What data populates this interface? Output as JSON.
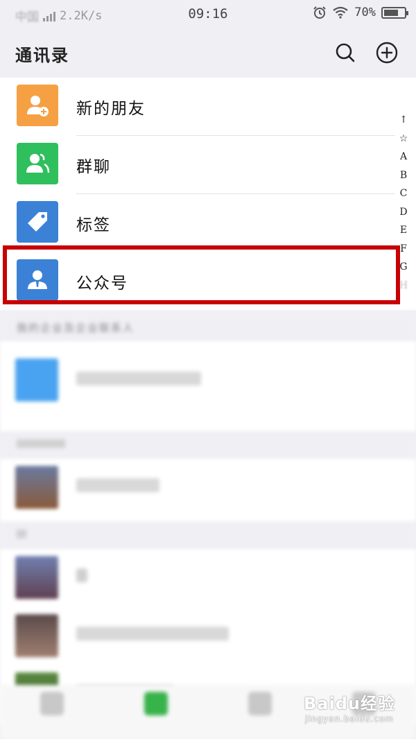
{
  "status_bar": {
    "network_speed": "2.2K/s",
    "time": "09:16",
    "battery": "70%",
    "battery_level": 0.7
  },
  "header": {
    "title": "通讯录",
    "icons": [
      "search-icon",
      "add-icon"
    ]
  },
  "menu": {
    "items": [
      {
        "label": "新的朋友",
        "icon": "new-friend-icon",
        "color": "#f5a043"
      },
      {
        "label": "群聊",
        "icon": "group-chat-icon",
        "color": "#2fbf5d"
      },
      {
        "label": "标签",
        "icon": "tag-icon",
        "color": "#3b82d6"
      },
      {
        "label": "公众号",
        "icon": "official-account-icon",
        "color": "#3b82d6"
      }
    ]
  },
  "enterprise_section": {
    "header": "我的企业及企业联系人"
  },
  "alphabet_index": [
    "↑",
    "☆",
    "A",
    "B",
    "C",
    "D",
    "E",
    "F",
    "G",
    "H"
  ],
  "tab_bar": {
    "active_color": "#38b34a"
  },
  "watermark": {
    "main": "Baidu经验",
    "sub": "jingyan.baidu.com"
  },
  "highlight_color": "#c80000"
}
